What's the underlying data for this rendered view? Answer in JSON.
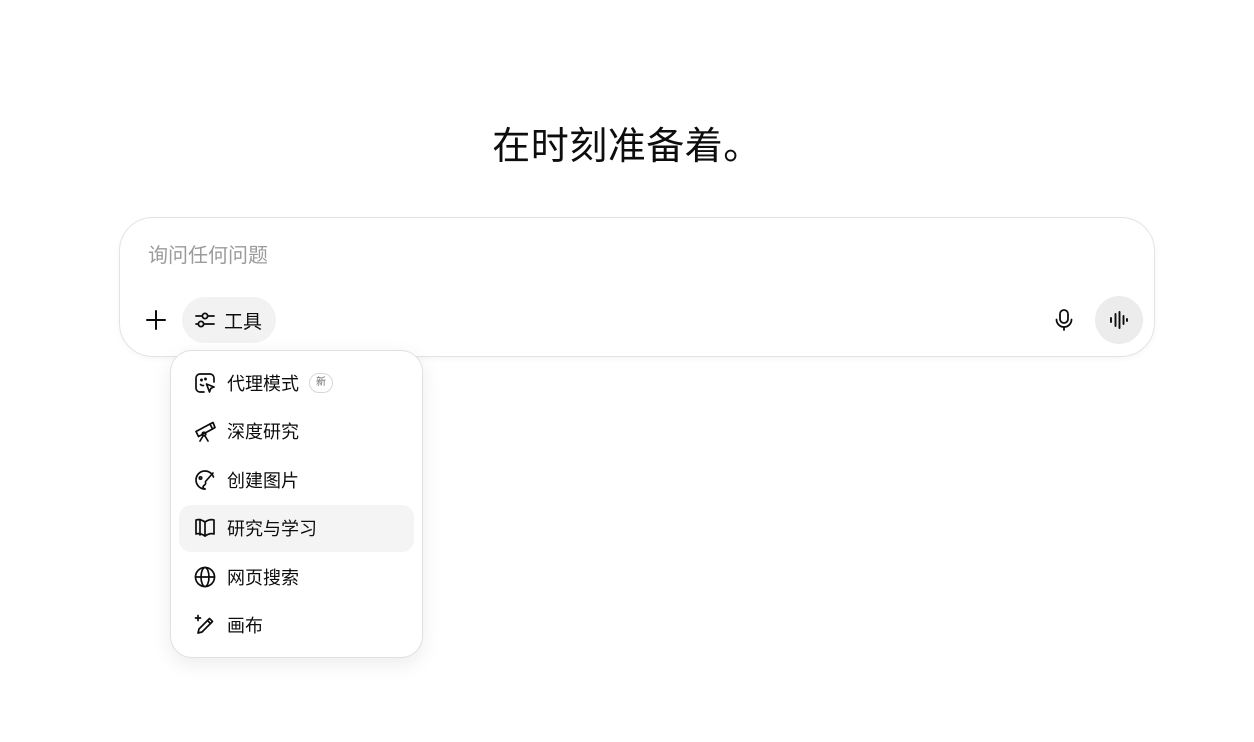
{
  "headline": "在时刻准备着。",
  "composer": {
    "placeholder": "询问任何问题",
    "value": "",
    "tools_label": "工具"
  },
  "tools_menu": {
    "items": [
      {
        "label": "代理模式",
        "icon": "agent-cursor-icon",
        "badge": "新"
      },
      {
        "label": "深度研究",
        "icon": "telescope-icon"
      },
      {
        "label": "创建图片",
        "icon": "palette-icon"
      },
      {
        "label": "研究与学习",
        "icon": "book-icon",
        "highlighted": true
      },
      {
        "label": "网页搜索",
        "icon": "globe-icon"
      },
      {
        "label": "画布",
        "icon": "sparkle-pen-icon"
      }
    ]
  },
  "colors": {
    "text": "#0d0d0d",
    "placeholder": "#9b9b9b",
    "chip_background": "#f2f2f2",
    "voice_button_background": "#ececec",
    "menu_hover": "#f4f4f4",
    "border": "#e3e3e3"
  }
}
